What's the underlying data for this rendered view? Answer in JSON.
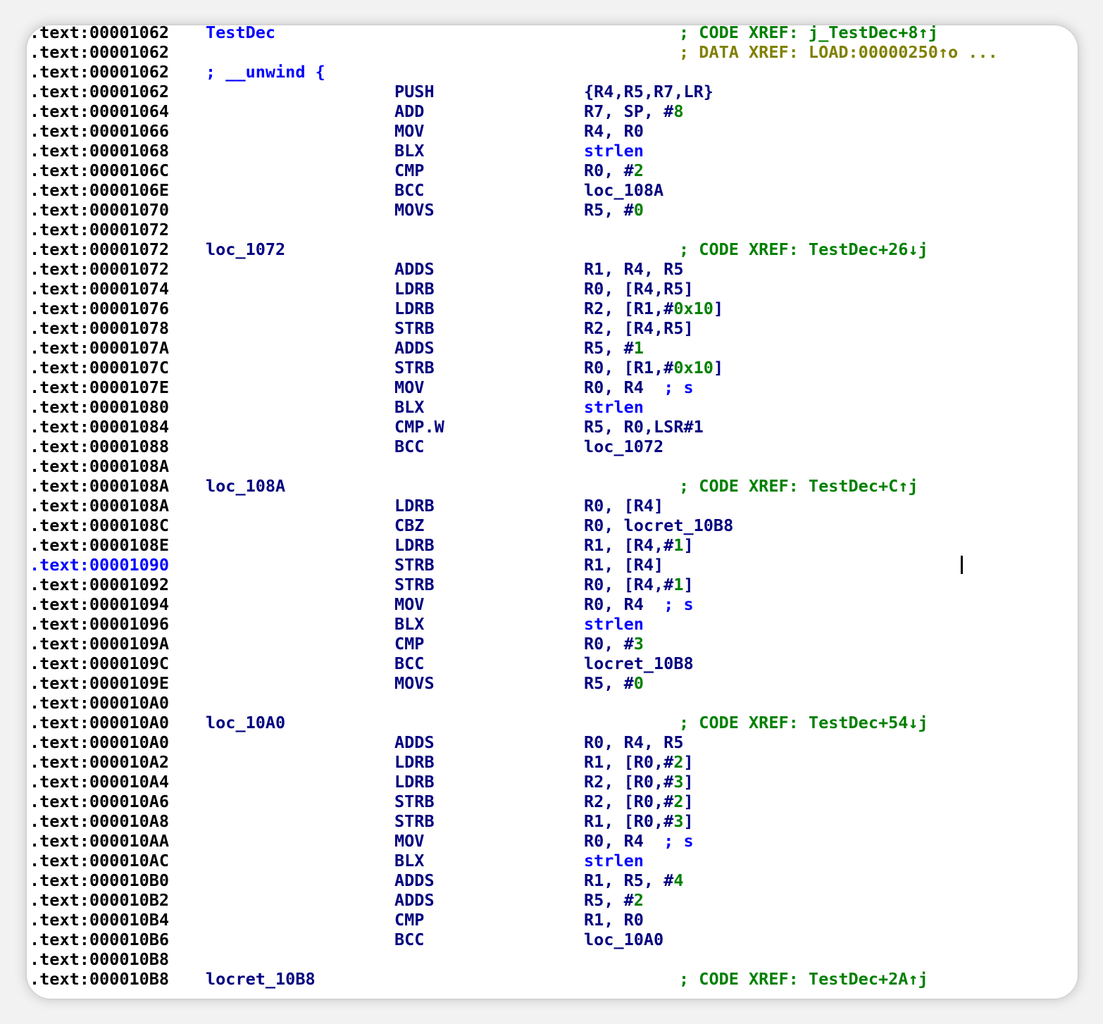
{
  "lines": [
    {
      "addr": ".text:00001062",
      "label": "TestDec",
      "label_kind": "func",
      "xref": "; CODE XREF: j_TestDec+8↑j"
    },
    {
      "addr": ".text:00001062",
      "xref": "; DATA XREF: LOAD:00000250↑o ...",
      "xref_kind": "data"
    },
    {
      "addr": ".text:00001062",
      "label": "; __unwind {",
      "label_kind": "cmt"
    },
    {
      "addr": ".text:00001062",
      "mnem": "PUSH",
      "ops": [
        {
          "t": "{R4,R5,R7,LR}"
        }
      ]
    },
    {
      "addr": ".text:00001064",
      "mnem": "ADD",
      "ops": [
        {
          "t": "R7, SP, #"
        },
        {
          "t": "8",
          "k": "num"
        }
      ]
    },
    {
      "addr": ".text:00001066",
      "mnem": "MOV",
      "ops": [
        {
          "t": "R4, R0"
        }
      ]
    },
    {
      "addr": ".text:00001068",
      "mnem": "BLX",
      "ops": [
        {
          "t": "strlen",
          "k": "ext"
        }
      ]
    },
    {
      "addr": ".text:0000106C",
      "mnem": "CMP",
      "ops": [
        {
          "t": "R0, #"
        },
        {
          "t": "2",
          "k": "num"
        }
      ]
    },
    {
      "addr": ".text:0000106E",
      "mnem": "BCC",
      "ops": [
        {
          "t": "loc_108A"
        }
      ]
    },
    {
      "addr": ".text:00001070",
      "mnem": "MOVS",
      "ops": [
        {
          "t": "R5, #"
        },
        {
          "t": "0",
          "k": "num"
        }
      ]
    },
    {
      "addr": ".text:00001072"
    },
    {
      "addr": ".text:00001072",
      "label": "loc_1072",
      "xref": "; CODE XREF: TestDec+26↓j"
    },
    {
      "addr": ".text:00001072",
      "mnem": "ADDS",
      "ops": [
        {
          "t": "R1, R4, R5"
        }
      ]
    },
    {
      "addr": ".text:00001074",
      "mnem": "LDRB",
      "ops": [
        {
          "t": "R0, [R4,R5]"
        }
      ]
    },
    {
      "addr": ".text:00001076",
      "mnem": "LDRB",
      "ops": [
        {
          "t": "R2, [R1,#"
        },
        {
          "t": "0x10",
          "k": "num"
        },
        {
          "t": "]"
        }
      ]
    },
    {
      "addr": ".text:00001078",
      "mnem": "STRB",
      "ops": [
        {
          "t": "R2, [R4,R5]"
        }
      ]
    },
    {
      "addr": ".text:0000107A",
      "mnem": "ADDS",
      "ops": [
        {
          "t": "R5, #"
        },
        {
          "t": "1",
          "k": "num"
        }
      ]
    },
    {
      "addr": ".text:0000107C",
      "mnem": "STRB",
      "ops": [
        {
          "t": "R0, [R1,#"
        },
        {
          "t": "0x10",
          "k": "num"
        },
        {
          "t": "]"
        }
      ]
    },
    {
      "addr": ".text:0000107E",
      "mnem": "MOV",
      "ops": [
        {
          "t": "R0, R4  "
        },
        {
          "t": "; s",
          "k": "scmt"
        }
      ]
    },
    {
      "addr": ".text:00001080",
      "mnem": "BLX",
      "ops": [
        {
          "t": "strlen",
          "k": "ext"
        }
      ]
    },
    {
      "addr": ".text:00001084",
      "mnem": "CMP.W",
      "ops": [
        {
          "t": "R5, R0,LSR#1"
        }
      ]
    },
    {
      "addr": ".text:00001088",
      "mnem": "BCC",
      "ops": [
        {
          "t": "loc_1072"
        }
      ]
    },
    {
      "addr": ".text:0000108A"
    },
    {
      "addr": ".text:0000108A",
      "label": "loc_108A",
      "xref": "; CODE XREF: TestDec+C↑j"
    },
    {
      "addr": ".text:0000108A",
      "mnem": "LDRB",
      "ops": [
        {
          "t": "R0, [R4]"
        }
      ]
    },
    {
      "addr": ".text:0000108C",
      "mnem": "CBZ",
      "ops": [
        {
          "t": "R0, locret_10B8"
        }
      ]
    },
    {
      "addr": ".text:0000108E",
      "mnem": "LDRB",
      "ops": [
        {
          "t": "R1, [R4,#"
        },
        {
          "t": "1",
          "k": "num"
        },
        {
          "t": "]"
        }
      ]
    },
    {
      "addr": ".text:00001090",
      "selected": true,
      "mnem": "STRB",
      "ops": [
        {
          "t": "R1, [R4]"
        }
      ]
    },
    {
      "addr": ".text:00001092",
      "mnem": "STRB",
      "ops": [
        {
          "t": "R0, [R4,#"
        },
        {
          "t": "1",
          "k": "num"
        },
        {
          "t": "]"
        }
      ]
    },
    {
      "addr": ".text:00001094",
      "mnem": "MOV",
      "ops": [
        {
          "t": "R0, R4  "
        },
        {
          "t": "; s",
          "k": "scmt"
        }
      ]
    },
    {
      "addr": ".text:00001096",
      "mnem": "BLX",
      "ops": [
        {
          "t": "strlen",
          "k": "ext"
        }
      ]
    },
    {
      "addr": ".text:0000109A",
      "mnem": "CMP",
      "ops": [
        {
          "t": "R0, #"
        },
        {
          "t": "3",
          "k": "num"
        }
      ]
    },
    {
      "addr": ".text:0000109C",
      "mnem": "BCC",
      "ops": [
        {
          "t": "locret_10B8"
        }
      ]
    },
    {
      "addr": ".text:0000109E",
      "mnem": "MOVS",
      "ops": [
        {
          "t": "R5, #"
        },
        {
          "t": "0",
          "k": "num"
        }
      ]
    },
    {
      "addr": ".text:000010A0"
    },
    {
      "addr": ".text:000010A0",
      "label": "loc_10A0",
      "xref": "; CODE XREF: TestDec+54↓j"
    },
    {
      "addr": ".text:000010A0",
      "mnem": "ADDS",
      "ops": [
        {
          "t": "R0, R4, R5"
        }
      ]
    },
    {
      "addr": ".text:000010A2",
      "mnem": "LDRB",
      "ops": [
        {
          "t": "R1, [R0,#"
        },
        {
          "t": "2",
          "k": "num"
        },
        {
          "t": "]"
        }
      ]
    },
    {
      "addr": ".text:000010A4",
      "mnem": "LDRB",
      "ops": [
        {
          "t": "R2, [R0,#"
        },
        {
          "t": "3",
          "k": "num"
        },
        {
          "t": "]"
        }
      ]
    },
    {
      "addr": ".text:000010A6",
      "mnem": "STRB",
      "ops": [
        {
          "t": "R2, [R0,#"
        },
        {
          "t": "2",
          "k": "num"
        },
        {
          "t": "]"
        }
      ]
    },
    {
      "addr": ".text:000010A8",
      "mnem": "STRB",
      "ops": [
        {
          "t": "R1, [R0,#"
        },
        {
          "t": "3",
          "k": "num"
        },
        {
          "t": "]"
        }
      ]
    },
    {
      "addr": ".text:000010AA",
      "mnem": "MOV",
      "ops": [
        {
          "t": "R0, R4  "
        },
        {
          "t": "; s",
          "k": "scmt"
        }
      ]
    },
    {
      "addr": ".text:000010AC",
      "mnem": "BLX",
      "ops": [
        {
          "t": "strlen",
          "k": "ext"
        }
      ]
    },
    {
      "addr": ".text:000010B0",
      "mnem": "ADDS",
      "ops": [
        {
          "t": "R1, R5, #"
        },
        {
          "t": "4",
          "k": "num"
        }
      ]
    },
    {
      "addr": ".text:000010B2",
      "mnem": "ADDS",
      "ops": [
        {
          "t": "R5, #"
        },
        {
          "t": "2",
          "k": "num"
        }
      ]
    },
    {
      "addr": ".text:000010B4",
      "mnem": "CMP",
      "ops": [
        {
          "t": "R1, R0"
        }
      ]
    },
    {
      "addr": ".text:000010B6",
      "mnem": "BCC",
      "ops": [
        {
          "t": "loc_10A0"
        }
      ]
    },
    {
      "addr": ".text:000010B8"
    },
    {
      "addr": ".text:000010B8",
      "label": "locret_10B8",
      "xref": "; CODE XREF: TestDec+2A↑j"
    }
  ]
}
